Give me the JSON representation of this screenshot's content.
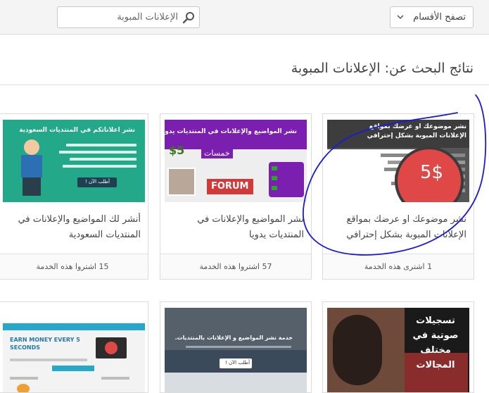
{
  "header": {
    "search_placeholder": "الإعلانات المبوبة",
    "browse_label": "تصفح الأقسام"
  },
  "results": {
    "title": "نتائج البحث عن: الإعلانات المبوبة"
  },
  "cards": [
    {
      "title": "نشر موضوعك او عرضك بمواقع الإعلانات المبوبة بشكل إحترافي",
      "sales": "1 اشترى هذه الخدمة",
      "thumb_heading": "نشر موضوعك او عرضك بمواقع الإعلانات المبوبة بشكل إحترافي",
      "thumb_price": "5$"
    },
    {
      "title": "نشر المواضيع والإعلانات في المنتديات يدويا",
      "sales": "57 اشتروا هذه الخدمة",
      "thumb_heading": "نشر المواضيع والإعلانات في المنتديات يدويا",
      "thumb_price": "$5",
      "thumb_sub": "خمسات",
      "thumb_forum": "FORUM"
    },
    {
      "title": "أنشر لك المواضيع والإعلانات في المنتديات السعودية",
      "sales": "15 اشتروا هذه الخدمة",
      "thumb_heading": "نشر اعلاناتكم في المنتديات السعودية",
      "thumb_button": "أطلب الآن !"
    },
    {
      "title": "",
      "thumb_heading": "تسجيلات صوتية في مختلف المجالات"
    },
    {
      "title": "",
      "thumb_heading": "خدمة نشر المواضيع و الإعلانات بالمنتديات.",
      "thumb_button": "أطلب الآن !"
    },
    {
      "title": "",
      "thumb_heading": "EARN MONEY EVERY 5 SECONDS"
    }
  ],
  "colors": {
    "annotation": "#1a1adb",
    "thumb1_bg": "#555555",
    "thumb1_price_circle": "#e04848",
    "thumb2_purple": "#7a1fb0",
    "thumb3_teal": "#23a88a"
  }
}
